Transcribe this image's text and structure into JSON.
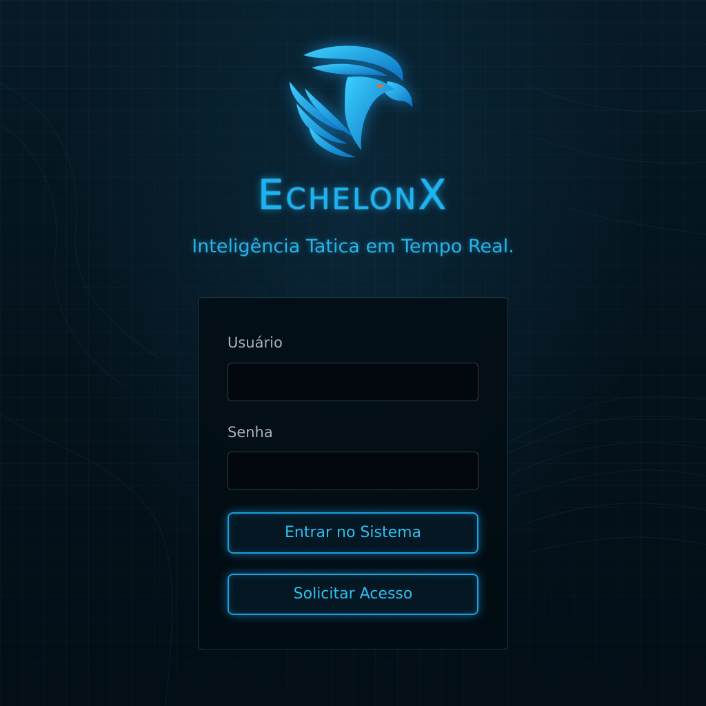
{
  "app": {
    "brand": "EchelonX",
    "tagline": "Inteligência Tatica em Tempo Real."
  },
  "logo": {
    "icon": "eagle-head-icon",
    "color": "#1ab4f5",
    "eye_color": "#ff6a1a"
  },
  "login": {
    "username_label": "Usuário",
    "username_value": "",
    "password_label": "Senha",
    "password_value": "",
    "submit_label": "Entrar no Sistema",
    "request_access_label": "Solicitar Acesso"
  },
  "colors": {
    "accent": "#1ab4f5",
    "background": "#04121b",
    "label": "#a7b4bc"
  }
}
